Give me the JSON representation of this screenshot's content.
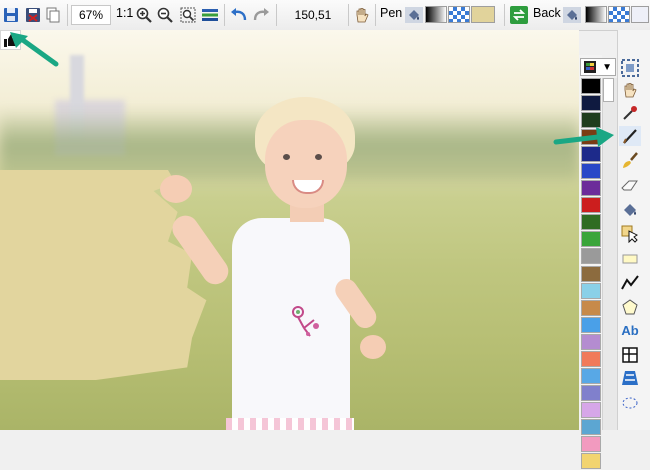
{
  "toolbar": {
    "zoom": "67%",
    "zoom_one_to_one": "1:1",
    "coordinates": "150,51",
    "pen_label": "Pen",
    "back_label": "Back"
  },
  "colors": {
    "foreground": "#e1d39b",
    "accent_arrow": "#1aa784",
    "swatches": [
      "#000000",
      "#0f1a40",
      "#1f3d1d",
      "#7a3c14",
      "#1d2a8a",
      "#2948c7",
      "#6c2c9a",
      "#cc1e1e",
      "#2f6c22",
      "#3aa53a",
      "#9a9a9a",
      "#8c6b3e",
      "#8ad0e8",
      "#c78a4a",
      "#4aa0e8",
      "#b48cd0",
      "#f07a5a",
      "#58a8e6",
      "#8080cc",
      "#d6a7e8",
      "#5ca6d2",
      "#f29abf",
      "#f2d470"
    ]
  },
  "icons": {
    "save": "save-icon",
    "save_all": "save-all-icon",
    "copy": "copy-icon",
    "zoom_in": "zoom-in-icon",
    "zoom_out": "zoom-out-icon",
    "zoom_fit": "zoom-fit-icon",
    "layers": "layers-icon",
    "undo": "undo-icon",
    "redo": "redo-icon",
    "hand": "hand-icon",
    "like": "thumbs-up-icon"
  }
}
